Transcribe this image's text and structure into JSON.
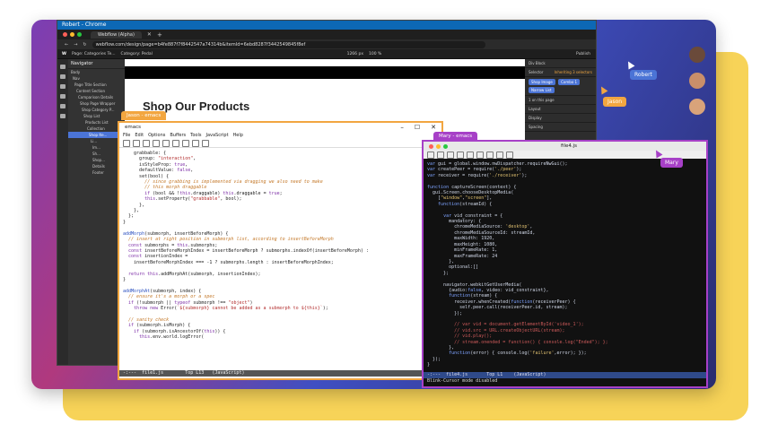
{
  "colors": {
    "jason": "#f2a640",
    "mary": "#a740c7",
    "robert": "#4b74d6"
  },
  "chrome": {
    "window_title": "Robert - Chrome",
    "tab_label": "Webflow (Alpha)",
    "url": "webflow.com/design/page=b4fe887f7f8442547a74314b&itemId=6ebd8287f3442549845f8ef"
  },
  "webflow": {
    "toolbar_page": "Page: Categories Te...",
    "toolbar_category": "Category: Pedal",
    "toolbar_size": "1266 px",
    "toolbar_zoom": "100 %",
    "toolbar_publish": "Publish",
    "navigator_title": "Navigator",
    "nav_items": [
      "Body",
      "Nav",
      "Page Title Section",
      "Content Section",
      "Comparison Details",
      "Shop Page Wrapper",
      "Shop Category P...",
      "Shop List",
      "Products List",
      "Collection",
      "Shop Ite...",
      "Li...",
      "Im...",
      "Sh...",
      "Shop...",
      "Details",
      "Footer"
    ],
    "page_heading": "Shop Our Products",
    "panel_selector_label": "Selector",
    "panel_inheriting": "Inheriting 3 selectors",
    "panel_chips": [
      "Shop Image",
      "Combo 1"
    ],
    "panel_chip_2": "Narrow List",
    "panel_on_this_page": "1 on this page",
    "panel_layout": "Layout",
    "panel_display": "Display",
    "panel_spacing": "Spacing",
    "panel_element": "Div Block"
  },
  "users": {
    "jason_label": "Jason",
    "mary_label": "Mary",
    "robert_label": "Robert",
    "jason_badge": "Jason - emacs",
    "mary_badge": "Mary - emacs"
  },
  "emacs_left": {
    "title": "emacs",
    "menu": [
      "File",
      "Edit",
      "Options",
      "Buffers",
      "Tools",
      "JavaScript",
      "Help"
    ],
    "modeline": "-:---  file1.js        Top L13   (JavaScript)"
  },
  "emacs_right": {
    "title": "file4.js",
    "modeline": "-:---  file4.js       Top L1    (JavaScript)",
    "echo": "Blink-Cursor mode disabled"
  }
}
